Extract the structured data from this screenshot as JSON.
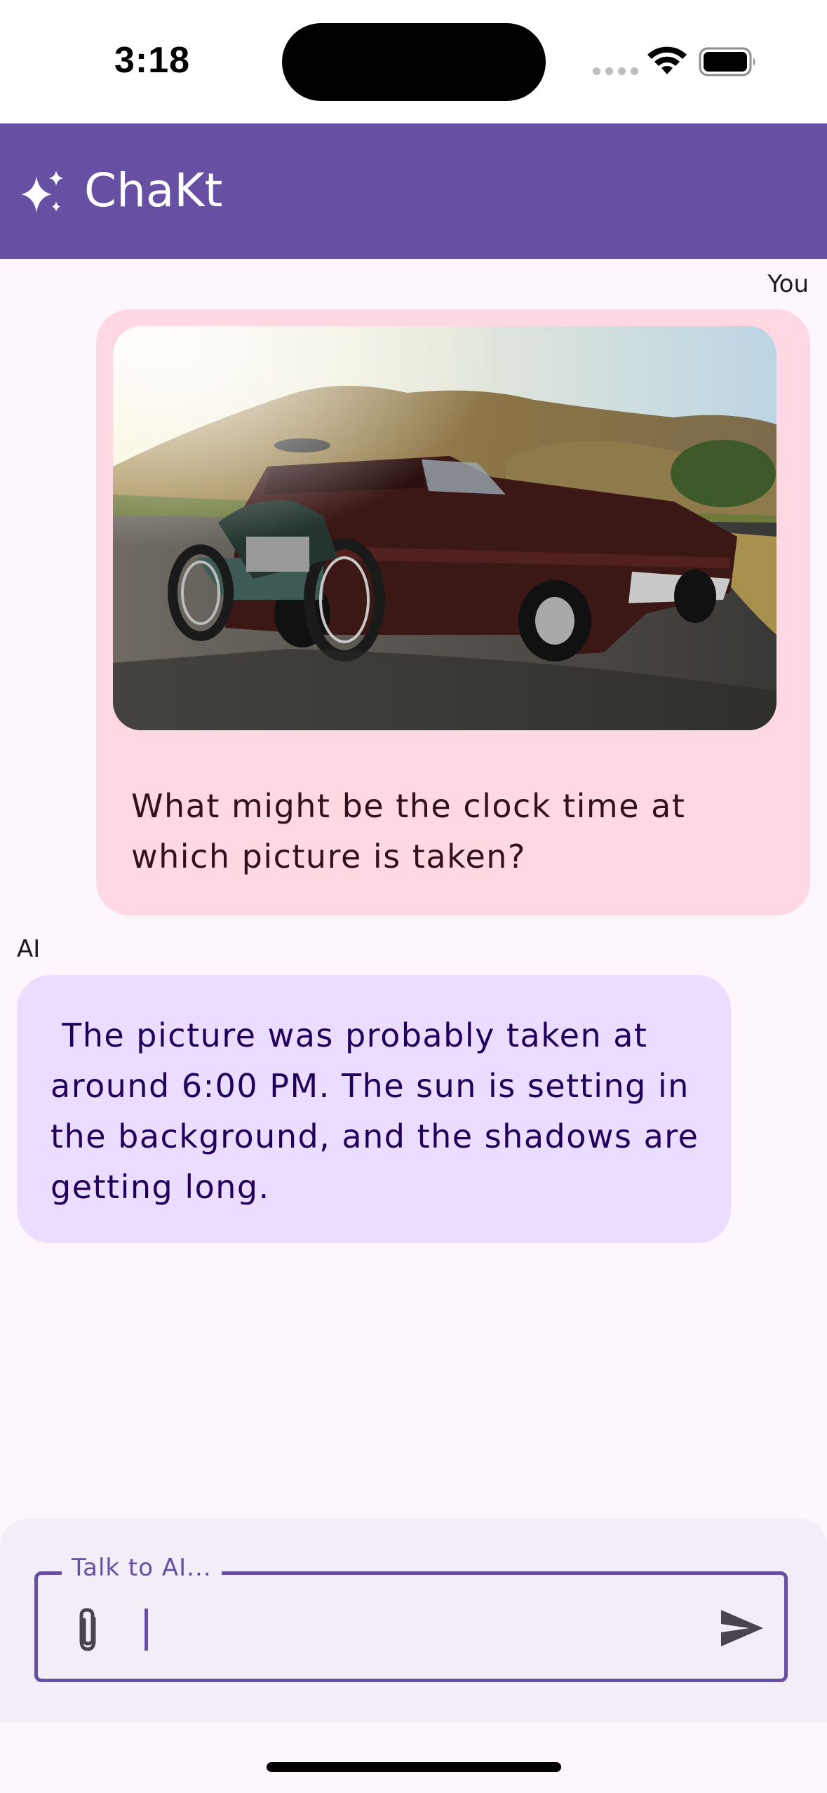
{
  "status_bar": {
    "time": "3:18",
    "icons": [
      "signal-icon",
      "wifi-icon",
      "battery-icon"
    ]
  },
  "app_bar": {
    "title": "ChaKt",
    "icon": "sparkle-icon",
    "color": "#6750A4"
  },
  "messages": [
    {
      "sender": "You",
      "has_image": true,
      "image_description_icon": "photo",
      "text": "What might be the clock time at which picture is taken?",
      "bubble_color": "#FFD8E4"
    },
    {
      "sender": "AI",
      "text": " The picture was probably taken at around 6:00 PM. The sun is setting in the background, and the shadows are getting long.",
      "bubble_color": "#EADDFF"
    }
  ],
  "composer": {
    "label": "Talk to AI...",
    "value": "",
    "attach_icon": "paperclip-icon",
    "send_icon": "send-icon"
  }
}
